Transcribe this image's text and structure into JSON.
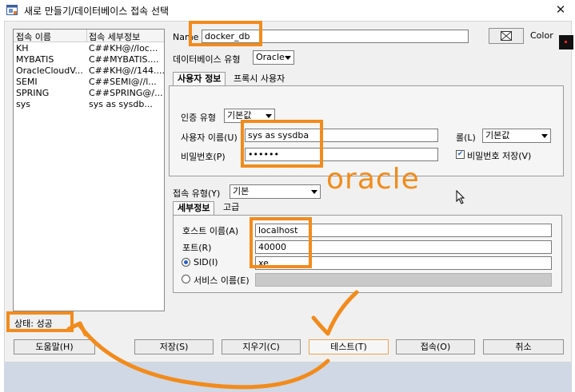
{
  "window": {
    "title": "새로 만들기/데이터베이스 접속 선택",
    "close_glyph": "✕"
  },
  "connections": {
    "headers": [
      "접속 이름",
      "접속 세부정보"
    ],
    "rows": [
      {
        "name": "KH",
        "detail": "C##KH@//loc..."
      },
      {
        "name": "MYBATIS",
        "detail": "C##MYBATIS...."
      },
      {
        "name": "OracleCloudV...",
        "detail": "C##KH@//144...."
      },
      {
        "name": "SEMI",
        "detail": "C##SEMI@//l..."
      },
      {
        "name": "SPRING",
        "detail": "C##SPRING@/..."
      },
      {
        "name": "sys",
        "detail": "sys as sysdb..."
      }
    ]
  },
  "status": "상태: 성공",
  "form": {
    "name_label": "Name",
    "name_value": "docker_db",
    "color_label": "Color",
    "db_type_label": "데이터베이스 유형",
    "db_type_value": "Oracle",
    "tabs": [
      "사용자 정보",
      "프록시 사용자"
    ],
    "auth_type_label": "인증 유형",
    "auth_type_value": "기본값",
    "username_label": "사용자 이름(U)",
    "username_value": "sys as sysdba",
    "role_label": "롤(L)",
    "role_value": "기본값",
    "password_label": "비밀번호(P)",
    "password_value": "••••••",
    "save_password_label": "비밀번호 저장(V)",
    "conn_type_label": "접속 유형(Y)",
    "conn_type_value": "기본",
    "detail_tabs": [
      "세부정보",
      "고급"
    ],
    "host_label": "호스트 이름(A)",
    "host_value": "localhost",
    "port_label": "포트(R)",
    "port_value": "40000",
    "sid_label": "SID(I)",
    "sid_value": "xe",
    "service_label": "서비스 이름(E)"
  },
  "annotation": {
    "handwritten_text": "oracle",
    "color": "#f28b1c"
  },
  "buttons": {
    "help": "도움말(H)",
    "save": "저장(S)",
    "clear": "지우기(C)",
    "test": "테스트(T)",
    "connect": "접속(O)",
    "cancel": "취소"
  }
}
